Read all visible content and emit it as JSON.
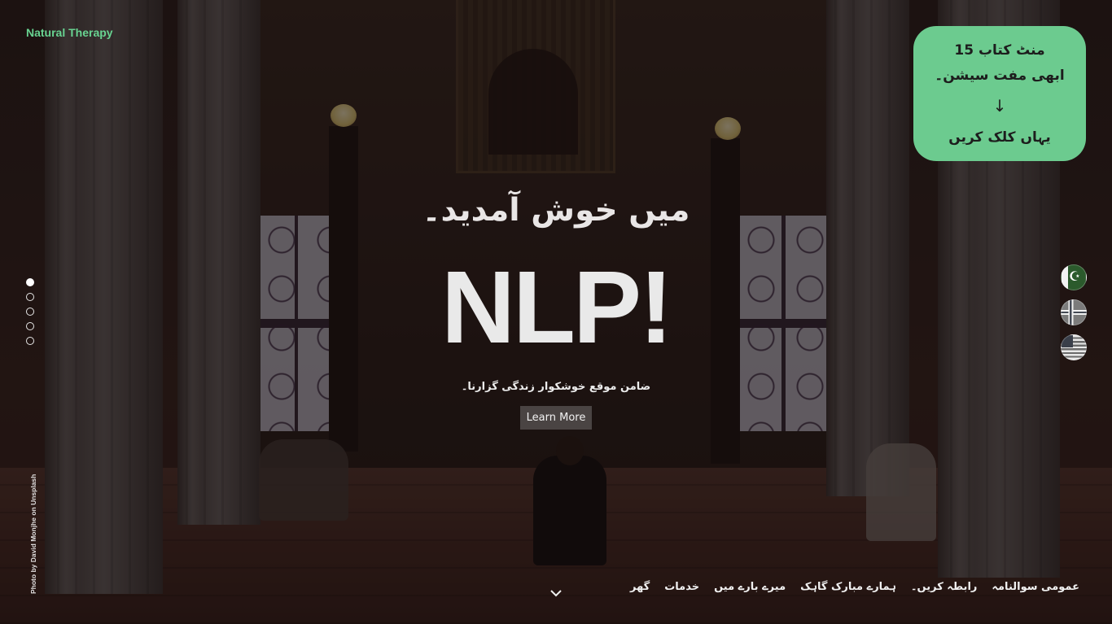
{
  "brand": {
    "name": "Natural Therapy"
  },
  "promo": {
    "line1": "منٹ کتاب 15",
    "line2": "ابھی مفت سیشن۔",
    "arrow": "↓",
    "line3": "یہاں کلک کریں"
  },
  "hero": {
    "welcome": "میں خوش آمدید۔",
    "title": "NLP!",
    "subtitle": "ضامن موقع خوشکوار زندگی گزارنا۔",
    "cta": "Learn More"
  },
  "slides": {
    "count": 5,
    "active": 1
  },
  "languages": [
    "pakistan-flag",
    "norway-flag",
    "usa-flag"
  ],
  "photo_credit": "Photo by David Monjhe on Unsplash",
  "nav": {
    "items": [
      "عمومی سوالنامہ",
      "رابطہ کریں۔",
      "ہمارے مبارک گاہک",
      "میرے بارے میں",
      "خدمات",
      "گھر"
    ]
  },
  "colors": {
    "accent": "#68d391",
    "promo_bg": "#6ccb8f"
  }
}
